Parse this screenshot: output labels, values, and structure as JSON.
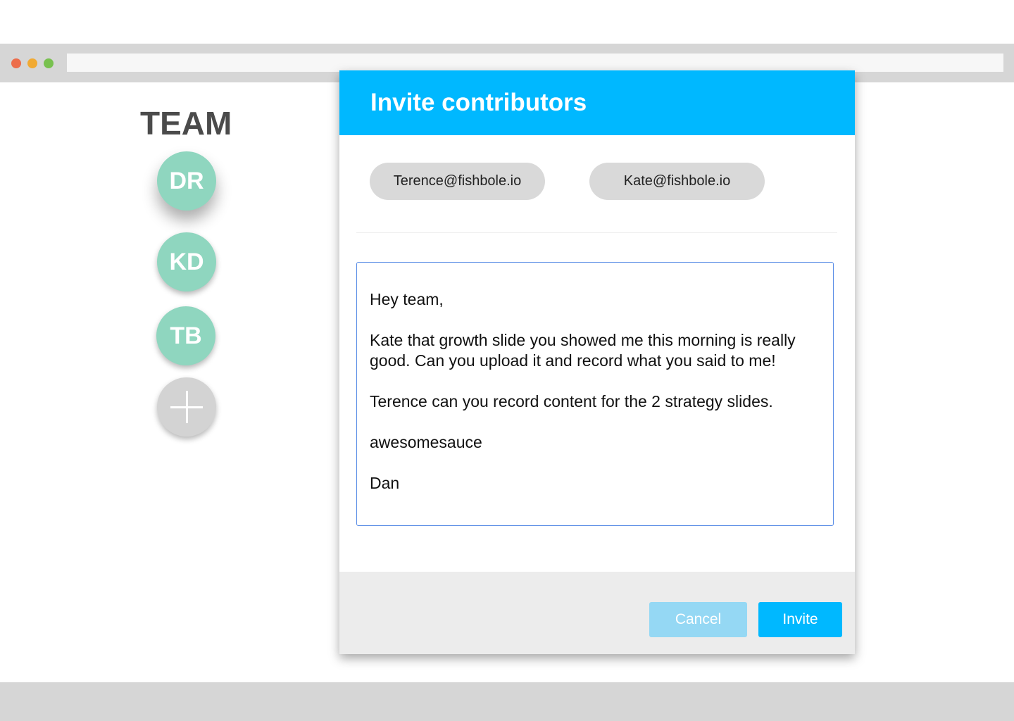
{
  "colors": {
    "accent": "#00b8ff",
    "avatar": "#8fd6bf",
    "add_avatar": "#d3d3d3",
    "cancel": "#95d8f4",
    "traffic_red": "#ec6d4b",
    "traffic_yellow": "#f1aa33",
    "traffic_green": "#78c14f"
  },
  "browser": {
    "icons": [
      "close-dot-icon",
      "minimize-dot-icon",
      "maximize-dot-icon"
    ],
    "address": ""
  },
  "sidebar": {
    "title": "TEAM",
    "members": [
      {
        "initials": "DR"
      },
      {
        "initials": "KD"
      },
      {
        "initials": "TB"
      }
    ],
    "add_icon": "plus-icon"
  },
  "modal": {
    "title": "Invite contributors",
    "recipients": [
      "Terence@fishbole.io",
      "Kate@fishbole.io"
    ],
    "message": {
      "greeting": "Hey team,",
      "paragraph1": "Kate that growth slide you showed me this morning is really good. Can you upload it and record what you said to me!",
      "paragraph2": "Terence can you record content for the 2 strategy slides.",
      "paragraph3": "awesomesauce",
      "signature": "Dan"
    },
    "cancel_label": "Cancel",
    "invite_label": "Invite"
  }
}
